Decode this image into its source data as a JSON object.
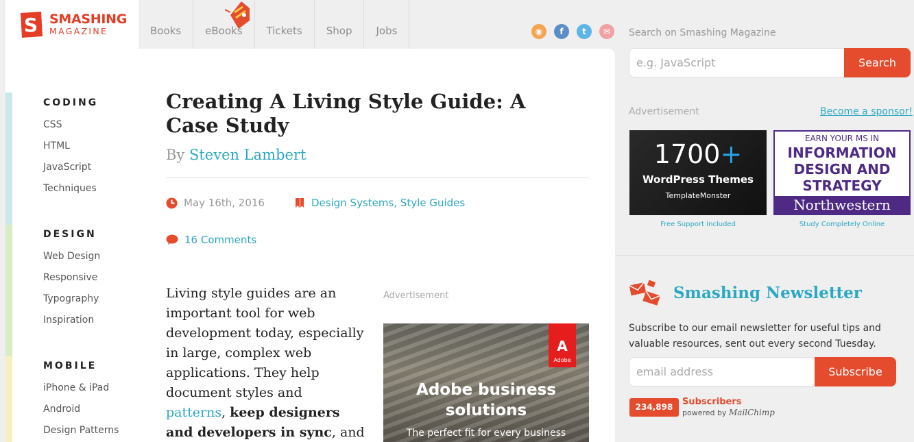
{
  "logo": {
    "line1": "SMASHING",
    "line2": "MAGAZINE",
    "letter": "S"
  },
  "nav": [
    "Books",
    "eBooks",
    "Tickets",
    "Shop",
    "Jobs"
  ],
  "social": [
    {
      "icon": "rss-icon",
      "glyph": "◉",
      "color": "#f2a552"
    },
    {
      "icon": "facebook-icon",
      "glyph": "f",
      "color": "#5b8ec6"
    },
    {
      "icon": "twitter-icon",
      "glyph": "t",
      "color": "#5db5e6"
    },
    {
      "icon": "email-icon",
      "glyph": "✉",
      "color": "#f0a1a4"
    }
  ],
  "categories": [
    {
      "heading": "CODING",
      "color": "#cde8ea",
      "links": [
        "CSS",
        "HTML",
        "JavaScript",
        "Techniques"
      ]
    },
    {
      "heading": "DESIGN",
      "color": "#d9ecc4",
      "links": [
        "Web Design",
        "Responsive",
        "Typography",
        "Inspiration"
      ]
    },
    {
      "heading": "MOBILE",
      "color": "#f5f0bf",
      "links": [
        "iPhone & iPad",
        "Android",
        "Design Patterns"
      ]
    }
  ],
  "article": {
    "title": "Creating A Living Style Guide: A Case Study",
    "by": "By",
    "author": "Steven Lambert",
    "date": "May 16th, 2016",
    "tag1": "Design Systems",
    "tag_sep": ",",
    "tag2": "Style Guides",
    "comments": "16 Comments",
    "body_plain": "Living style guides are an important tool for web development today, especially in large, complex web applications. They help document styles and",
    "body_link": "patterns",
    "body_bold": "keep designers and developers in sync",
    "body_tail": ", and"
  },
  "main_ad": {
    "label": "Advertisement",
    "logo_text": "Adobe",
    "headline": "Adobe business solutions",
    "sub": "The perfect fit for every business"
  },
  "sidebar": {
    "search_label": "Search on Smashing Magazine",
    "search_placeholder": "e.g. JavaScript",
    "search_button": "Search",
    "ad_label": "Advertisement",
    "sponsor_link": "Become a sponsor!",
    "ad1": {
      "big": "1700",
      "plus": "+",
      "mid": "WordPress Themes",
      "brand": "TemplateMonster",
      "caption": "Free Support Included"
    },
    "ad2": {
      "top": "EARN YOUR MS IN",
      "main": "INFORMATION DESIGN AND STRATEGY",
      "school": "Northwestern",
      "caption": "Study Completely Online"
    },
    "newsletter_title": "Smashing Newsletter",
    "newsletter_desc": "Subscribe to our email newsletter for useful tips and valuable resources, sent out every second Tuesday.",
    "email_placeholder": "email address",
    "subscribe_button": "Subscribe",
    "subscriber_count": "234,898",
    "subscriber_label": "Subscribers",
    "powered_by": "powered by",
    "mailchimp": "MailChimp"
  },
  "colors": {
    "accent": "#e54c2e",
    "link": "#2ca8c2",
    "brand": "#e53d26"
  }
}
